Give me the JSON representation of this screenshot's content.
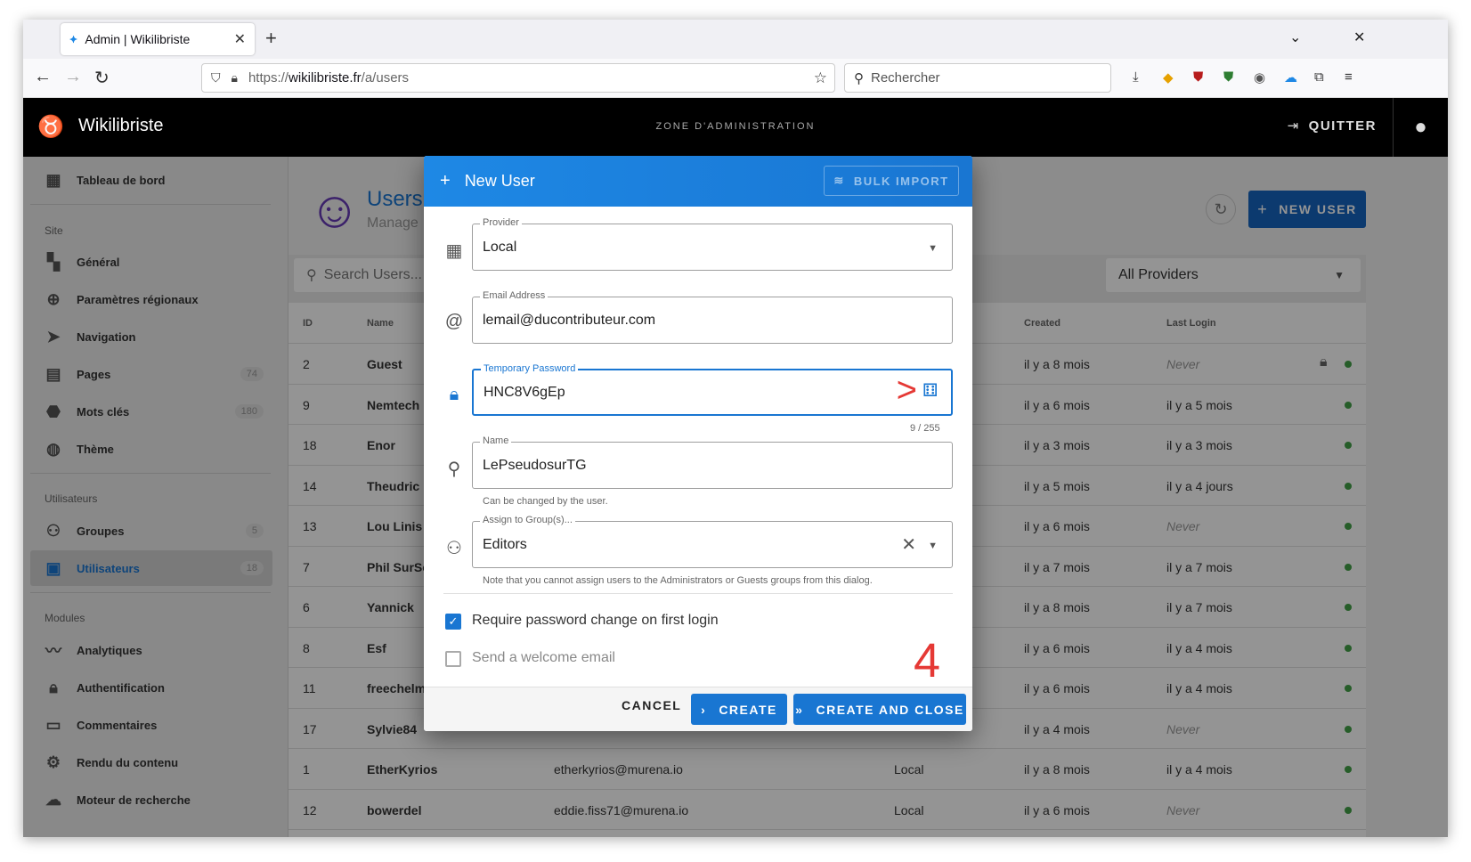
{
  "browser": {
    "tab_title": "Admin | Wikilibriste",
    "url_prefix": "https://",
    "url_domain": "wikilibriste.fr",
    "url_path": "/a/users",
    "search_placeholder": "Rechercher"
  },
  "app": {
    "site_name": "Wikilibriste",
    "zone_label": "ZONE D'ADMINISTRATION",
    "quit_label": "QUITTER"
  },
  "sidebar": {
    "dashboard": "Tableau de bord",
    "section_site": "Site",
    "general": "Général",
    "regional": "Paramètres régionaux",
    "navigation": "Navigation",
    "pages": "Pages",
    "pages_count": "74",
    "tags": "Mots clés",
    "tags_count": "180",
    "theme": "Thème",
    "section_users": "Utilisateurs",
    "groups": "Groupes",
    "groups_count": "5",
    "users": "Utilisateurs",
    "users_count": "18",
    "section_modules": "Modules",
    "analytics": "Analytiques",
    "auth": "Authentification",
    "comments": "Commentaires",
    "rendering": "Rendu du contenu",
    "search_engine": "Moteur de recherche"
  },
  "main": {
    "title": "Users",
    "subtitle": "Manage",
    "new_user": "NEW USER",
    "search_placeholder": "Search Users...",
    "provider_filter": "All Providers",
    "columns": {
      "id": "ID",
      "name": "Name",
      "created": "Created",
      "last_login": "Last Login"
    },
    "rows": [
      {
        "id": "2",
        "name": "Guest",
        "email": "",
        "provider": "",
        "created": "il y a 8 mois",
        "last": "Never"
      },
      {
        "id": "9",
        "name": "Nemtech",
        "email": "",
        "provider": "",
        "created": "il y a 6 mois",
        "last": "il y a 5 mois"
      },
      {
        "id": "18",
        "name": "Enor",
        "email": "",
        "provider": "",
        "created": "il y a 3 mois",
        "last": "il y a 3 mois"
      },
      {
        "id": "14",
        "name": "Theudric",
        "email": "",
        "provider": "",
        "created": "il y a 5 mois",
        "last": "il y a 4 jours"
      },
      {
        "id": "13",
        "name": "Lou Linis",
        "email": "",
        "provider": "",
        "created": "il y a 6 mois",
        "last": "Never"
      },
      {
        "id": "7",
        "name": "Phil SurSo",
        "email": "",
        "provider": "",
        "created": "il y a 7 mois",
        "last": "il y a 7 mois"
      },
      {
        "id": "6",
        "name": "Yannick",
        "email": "",
        "provider": "",
        "created": "il y a 8 mois",
        "last": "il y a 7 mois"
      },
      {
        "id": "8",
        "name": "Esf",
        "email": "",
        "provider": "",
        "created": "il y a 6 mois",
        "last": "il y a 4 mois"
      },
      {
        "id": "11",
        "name": "freechelmi",
        "email": "",
        "provider": "",
        "created": "il y a 6 mois",
        "last": "il y a 4 mois"
      },
      {
        "id": "17",
        "name": "Sylvie84",
        "email": "",
        "provider": "",
        "created": "il y a 4 mois",
        "last": "Never"
      },
      {
        "id": "1",
        "name": "EtherKyrios",
        "email": "etherkyrios@murena.io",
        "provider": "Local",
        "created": "il y a 8 mois",
        "last": "il y a 4 mois"
      },
      {
        "id": "12",
        "name": "bowerdel",
        "email": "eddie.fiss71@murena.io",
        "provider": "Local",
        "created": "il y a 6 mois",
        "last": "Never"
      }
    ]
  },
  "modal": {
    "title": "New User",
    "bulk_import": "BULK IMPORT",
    "provider_label": "Provider",
    "provider_value": "Local",
    "email_label": "Email Address",
    "email_value": "lemail@ducontributeur.com",
    "password_label": "Temporary Password",
    "password_value": "HNC8V6gEp",
    "password_counter": "9 / 255",
    "name_label": "Name",
    "name_value": "LePseudosurTG",
    "name_hint": "Can be changed by the user.",
    "groups_label": "Assign to Group(s)...",
    "groups_value": "Editors",
    "groups_hint": "Note that you cannot assign users to the Administrators or Guests groups from this dialog.",
    "require_change": "Require password change on first login",
    "welcome_email": "Send a welcome email",
    "cancel": "CANCEL",
    "create": "CREATE",
    "create_close": "CREATE AND CLOSE",
    "annotation_arrow": ">",
    "annotation_step": "4"
  },
  "colors": {
    "accent": "#1976d2",
    "annotation": "#e53935",
    "status_online": "#43a047"
  }
}
